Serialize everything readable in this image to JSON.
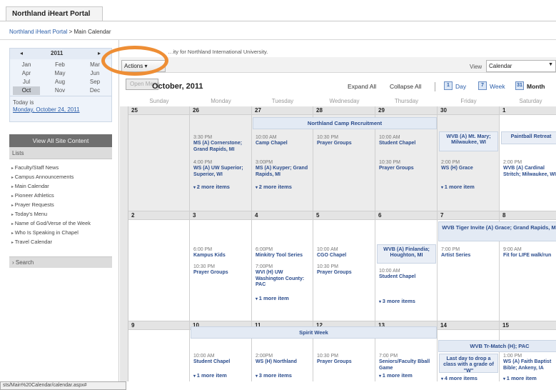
{
  "app": {
    "title_tab": "Northland iHeart Portal"
  },
  "breadcrumb": {
    "root": "Northland iHeart Portal",
    "separator": " > ",
    "current": "Main Calendar"
  },
  "ribbon_text": "…ity for Northland International University.",
  "sidebar": {
    "datepicker": {
      "prev": "◂",
      "next": "▸",
      "year": "2011",
      "months": [
        "Jan",
        "Feb",
        "Mar",
        "Apr",
        "May",
        "Jun",
        "Jul",
        "Aug",
        "Sep",
        "Oct",
        "Nov",
        "Dec"
      ],
      "selected_month": "Oct",
      "today_label": "Today is",
      "today_value": "Monday, October 24, 2011"
    },
    "view_all": "View All Site Content",
    "lists_header": "Lists",
    "lists": [
      "Faculty/Staff News",
      "Campus Announcements",
      "Main Calendar",
      "Pioneer Athletics",
      "Prayer Requests",
      "Today's Menu",
      "Name of God/Verse of the Week",
      "Who Is Speaking in Chapel",
      "Travel Calendar"
    ],
    "search": "Search"
  },
  "status_bar": "sts/Main%20Calendar/calendar.aspx#",
  "toolbar": {
    "actions": "Actions ▾",
    "view_label": "View",
    "view_value": "Calendar"
  },
  "nav": {
    "open_menu": "Open Menu",
    "month_title": "October, 2011",
    "expand_all": "Expand All",
    "collapse_all": "Collapse All",
    "day": "Day",
    "day_icon": "1",
    "week": "Week",
    "week_icon": "7",
    "month": "Month",
    "month_icon": "31"
  },
  "calendar": {
    "days": [
      "Sunday",
      "Monday",
      "Tuesday",
      "Wednesday",
      "Thursday",
      "Friday",
      "Saturday"
    ],
    "week1": {
      "nums": [
        "25",
        "26",
        "27",
        "28",
        "29",
        "30",
        "1"
      ],
      "band": "Northland Camp Recruitment",
      "mon": [
        {
          "time": "3:30 PM",
          "name": "MS (A) Cornerstone; Grand Rapids, MI"
        },
        {
          "time": "4:00 PM",
          "name": "WS (A) UW Superior; Superior, WI"
        }
      ],
      "mon_more": "2 more items",
      "tue": [
        {
          "time": "10:00 AM",
          "name": "Camp Chapel"
        },
        {
          "time": "3:00PM",
          "name": "MS (A) Kuyper; Grand Rapids, MI"
        }
      ],
      "tue_more": "2 more items",
      "wed": [
        {
          "time": "10:30 PM",
          "name": "Prayer Groups"
        }
      ],
      "thu": [
        {
          "time": "10:00 AM",
          "name": "Student Chapel"
        },
        {
          "time": "10:30 PM",
          "name": "Prayer Groups"
        }
      ],
      "fri_box": "WVB (A) Mt. Mary; Milwaukee, WI",
      "fri": [
        {
          "time": "2:00 PM",
          "name": "WS (H) Grace"
        }
      ],
      "fri_more": "1 more item",
      "sat_box": "Paintball Retreat",
      "sat": [
        {
          "time": "2:00 PM",
          "name": "WVB (A) Cardinal Stritch; Milwaukee, WI"
        }
      ]
    },
    "week2": {
      "nums": [
        "2",
        "3",
        "4",
        "5",
        "6",
        "7",
        "8"
      ],
      "band": "WVB Tiger Invite (A) Grace; Grand Rapids, MI",
      "mon": [
        {
          "time": "6:00 PM",
          "name": "Kampus Kids"
        },
        {
          "time": "10:30 PM",
          "name": "Prayer Groups"
        }
      ],
      "tue": [
        {
          "time": "6:00PM",
          "name": "Minkitry Tool Series"
        },
        {
          "time": "7:00PM",
          "name": "WVI (H) UW Washington County: PAC"
        }
      ],
      "tue_more": "1 more item",
      "wed": [
        {
          "time": "10:00 AM",
          "name": "CGO Chapel"
        },
        {
          "time": "10:30 PM",
          "name": "Prayer Groups"
        }
      ],
      "thu_box": "WVB (A) Finlandia; Houghton, MI",
      "thu": [
        {
          "time": "10:00 AM",
          "name": "Student Chapel"
        }
      ],
      "thu_more": "3 more items",
      "fri": [
        {
          "time": "7:00 PM",
          "name": "Artist Series"
        }
      ],
      "sat": [
        {
          "time": "9:00 AM",
          "name": "Fit for LIFE walk/run"
        }
      ]
    },
    "week3": {
      "nums": [
        "9",
        "10",
        "11",
        "12",
        "13",
        "14",
        "15"
      ],
      "band": "Spirit Week",
      "band2": "WVB Tr-Match (H); PAC",
      "mon": [
        {
          "time": "10:00 AM",
          "name": "Student Chapel"
        }
      ],
      "mon_more": "1 more item",
      "tue": [
        {
          "time": "2:00PM",
          "name": "WS (H) Northland"
        }
      ],
      "tue_more": "3 more items",
      "wed": [
        {
          "time": "10:30 PM",
          "name": "Prayer Groups"
        }
      ],
      "thu": [
        {
          "time": "7:00 PM",
          "name": "Seniors/Faculty Bball Game"
        }
      ],
      "thu_more": "1 more item",
      "fri_box": "Last day to drop a class with a grade of \"W\"",
      "fri_more": "4 more items",
      "sat": [
        {
          "time": "1:00 PM",
          "name": "WS (A) Faith Baptist Bible; Ankeny, IA"
        }
      ],
      "sat_more": "1 more item"
    }
  }
}
